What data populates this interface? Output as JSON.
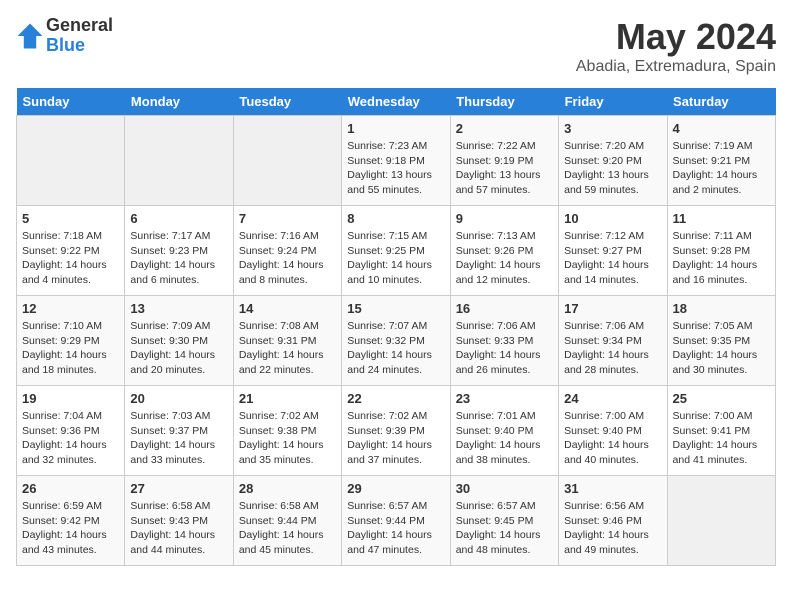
{
  "logo": {
    "general": "General",
    "blue": "Blue"
  },
  "title": "May 2024",
  "location": "Abadia, Extremadura, Spain",
  "days_of_week": [
    "Sunday",
    "Monday",
    "Tuesday",
    "Wednesday",
    "Thursday",
    "Friday",
    "Saturday"
  ],
  "weeks": [
    [
      {
        "day": "",
        "info": ""
      },
      {
        "day": "",
        "info": ""
      },
      {
        "day": "",
        "info": ""
      },
      {
        "day": "1",
        "info": "Sunrise: 7:23 AM\nSunset: 9:18 PM\nDaylight: 13 hours\nand 55 minutes."
      },
      {
        "day": "2",
        "info": "Sunrise: 7:22 AM\nSunset: 9:19 PM\nDaylight: 13 hours\nand 57 minutes."
      },
      {
        "day": "3",
        "info": "Sunrise: 7:20 AM\nSunset: 9:20 PM\nDaylight: 13 hours\nand 59 minutes."
      },
      {
        "day": "4",
        "info": "Sunrise: 7:19 AM\nSunset: 9:21 PM\nDaylight: 14 hours\nand 2 minutes."
      }
    ],
    [
      {
        "day": "5",
        "info": "Sunrise: 7:18 AM\nSunset: 9:22 PM\nDaylight: 14 hours\nand 4 minutes."
      },
      {
        "day": "6",
        "info": "Sunrise: 7:17 AM\nSunset: 9:23 PM\nDaylight: 14 hours\nand 6 minutes."
      },
      {
        "day": "7",
        "info": "Sunrise: 7:16 AM\nSunset: 9:24 PM\nDaylight: 14 hours\nand 8 minutes."
      },
      {
        "day": "8",
        "info": "Sunrise: 7:15 AM\nSunset: 9:25 PM\nDaylight: 14 hours\nand 10 minutes."
      },
      {
        "day": "9",
        "info": "Sunrise: 7:13 AM\nSunset: 9:26 PM\nDaylight: 14 hours\nand 12 minutes."
      },
      {
        "day": "10",
        "info": "Sunrise: 7:12 AM\nSunset: 9:27 PM\nDaylight: 14 hours\nand 14 minutes."
      },
      {
        "day": "11",
        "info": "Sunrise: 7:11 AM\nSunset: 9:28 PM\nDaylight: 14 hours\nand 16 minutes."
      }
    ],
    [
      {
        "day": "12",
        "info": "Sunrise: 7:10 AM\nSunset: 9:29 PM\nDaylight: 14 hours\nand 18 minutes."
      },
      {
        "day": "13",
        "info": "Sunrise: 7:09 AM\nSunset: 9:30 PM\nDaylight: 14 hours\nand 20 minutes."
      },
      {
        "day": "14",
        "info": "Sunrise: 7:08 AM\nSunset: 9:31 PM\nDaylight: 14 hours\nand 22 minutes."
      },
      {
        "day": "15",
        "info": "Sunrise: 7:07 AM\nSunset: 9:32 PM\nDaylight: 14 hours\nand 24 minutes."
      },
      {
        "day": "16",
        "info": "Sunrise: 7:06 AM\nSunset: 9:33 PM\nDaylight: 14 hours\nand 26 minutes."
      },
      {
        "day": "17",
        "info": "Sunrise: 7:06 AM\nSunset: 9:34 PM\nDaylight: 14 hours\nand 28 minutes."
      },
      {
        "day": "18",
        "info": "Sunrise: 7:05 AM\nSunset: 9:35 PM\nDaylight: 14 hours\nand 30 minutes."
      }
    ],
    [
      {
        "day": "19",
        "info": "Sunrise: 7:04 AM\nSunset: 9:36 PM\nDaylight: 14 hours\nand 32 minutes."
      },
      {
        "day": "20",
        "info": "Sunrise: 7:03 AM\nSunset: 9:37 PM\nDaylight: 14 hours\nand 33 minutes."
      },
      {
        "day": "21",
        "info": "Sunrise: 7:02 AM\nSunset: 9:38 PM\nDaylight: 14 hours\nand 35 minutes."
      },
      {
        "day": "22",
        "info": "Sunrise: 7:02 AM\nSunset: 9:39 PM\nDaylight: 14 hours\nand 37 minutes."
      },
      {
        "day": "23",
        "info": "Sunrise: 7:01 AM\nSunset: 9:40 PM\nDaylight: 14 hours\nand 38 minutes."
      },
      {
        "day": "24",
        "info": "Sunrise: 7:00 AM\nSunset: 9:40 PM\nDaylight: 14 hours\nand 40 minutes."
      },
      {
        "day": "25",
        "info": "Sunrise: 7:00 AM\nSunset: 9:41 PM\nDaylight: 14 hours\nand 41 minutes."
      }
    ],
    [
      {
        "day": "26",
        "info": "Sunrise: 6:59 AM\nSunset: 9:42 PM\nDaylight: 14 hours\nand 43 minutes."
      },
      {
        "day": "27",
        "info": "Sunrise: 6:58 AM\nSunset: 9:43 PM\nDaylight: 14 hours\nand 44 minutes."
      },
      {
        "day": "28",
        "info": "Sunrise: 6:58 AM\nSunset: 9:44 PM\nDaylight: 14 hours\nand 45 minutes."
      },
      {
        "day": "29",
        "info": "Sunrise: 6:57 AM\nSunset: 9:44 PM\nDaylight: 14 hours\nand 47 minutes."
      },
      {
        "day": "30",
        "info": "Sunrise: 6:57 AM\nSunset: 9:45 PM\nDaylight: 14 hours\nand 48 minutes."
      },
      {
        "day": "31",
        "info": "Sunrise: 6:56 AM\nSunset: 9:46 PM\nDaylight: 14 hours\nand 49 minutes."
      },
      {
        "day": "",
        "info": ""
      }
    ]
  ]
}
